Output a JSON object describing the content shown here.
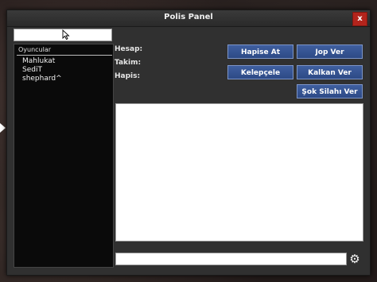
{
  "window": {
    "title": "Polis Panel",
    "close_label": "x"
  },
  "player_panel": {
    "search_value": "",
    "header": "Oyuncular",
    "players": [
      "Mahlukat",
      "SediT",
      "shephard^"
    ]
  },
  "info": {
    "hesap_label": "Hesap:",
    "takim_label": "Takim:",
    "hapis_label": "Hapis:"
  },
  "actions": {
    "hapise_at": "Hapise At",
    "jop_ver": "Jop Ver",
    "kelepcele": "Kelepçele",
    "kalkan_ver": "Kalkan Ver",
    "sok_silahi_ver": "Şok Silahı Ver"
  },
  "chat": {
    "value": ""
  },
  "icons": {
    "settings": "gear-icon",
    "cursor": "mouse-pointer-icon",
    "side": "arrow-right-icon"
  },
  "colors": {
    "button": "#3a5a9c",
    "close": "#b3241c",
    "window": "#303030"
  }
}
